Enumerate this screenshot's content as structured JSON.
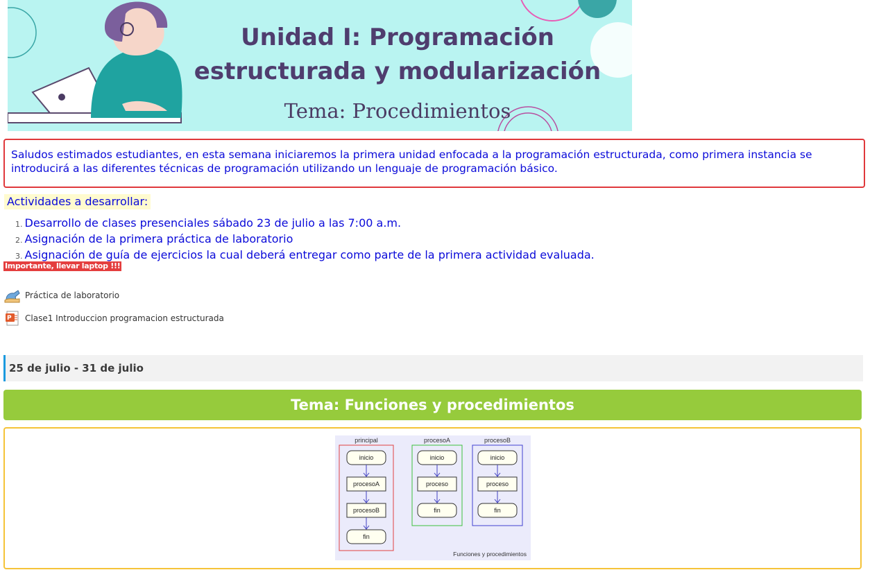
{
  "banner": {
    "title_line1": "Unidad I: Programación",
    "title_line2": "estructurada y modularización",
    "subtitle": "Tema: Procedimientos"
  },
  "intro": {
    "text": "Saludos estimados estudiantes, en esta semana iniciaremos la primera unidad enfocada a la programación estructurada, como primera instancia se introducirá a las diferentes técnicas de programación utilizando  un lenguaje de programación básico."
  },
  "activities": {
    "title": "Actividades a desarrollar:",
    "items": [
      {
        "num": "1.",
        "text": "Desarrollo de clases presenciales sábado 23 de julio a las 7:00 a.m."
      },
      {
        "num": "2.",
        "text": "Asignación de la primera práctica de laboratorio"
      },
      {
        "num": "3.",
        "text": "Asignación de guía de ejercicios la cual deberá entregar como parte de la primera actividad evaluada."
      }
    ],
    "important": "Importante, llevar laptop !!!"
  },
  "resources": [
    {
      "label": "Práctica de laboratorio",
      "icon": "assignment-icon"
    },
    {
      "label": "Clase1 Introduccion programacion estructurada",
      "icon": "powerpoint-icon"
    }
  ],
  "week": {
    "label": "25 de julio - 31 de julio"
  },
  "topic": {
    "title": "Tema: Funciones y procedimientos"
  },
  "diagram": {
    "caption": "Funciones y procedimientos",
    "columns": [
      {
        "name": "principal",
        "color": "#e04040",
        "nodes": [
          "inicio",
          "procesoA",
          "procesoB",
          "fin"
        ]
      },
      {
        "name": "procesoA",
        "color": "#3cc03c",
        "nodes": [
          "inicio",
          "proceso",
          "fin"
        ]
      },
      {
        "name": "procesoB",
        "color": "#4040d0",
        "nodes": [
          "inicio",
          "proceso",
          "fin"
        ]
      }
    ]
  },
  "colors": {
    "intro_border": "#e0383b",
    "text_blue": "#0a0ad9",
    "important_bg": "#e43e3e",
    "week_accent": "#1b9adf",
    "topic_bar": "#96cb3c",
    "diagram_border": "#f5c338"
  }
}
